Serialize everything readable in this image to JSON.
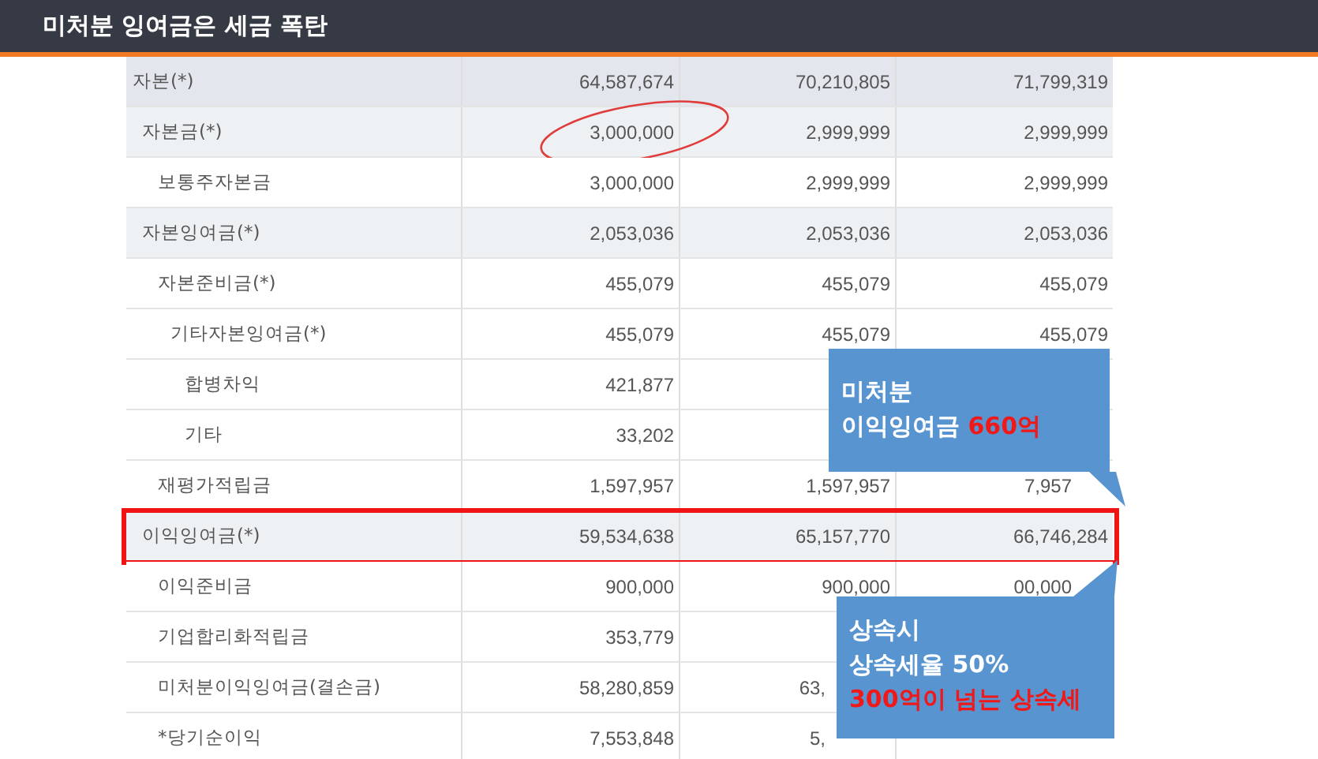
{
  "title": "미처분 잉여금은 세금 폭탄",
  "rows": [
    {
      "label": "자본(*)",
      "column_2": "64,587,674",
      "column_3": "70,210,805",
      "column_4": "71,799,319",
      "circled": false,
      "boxed": false,
      "children": [
        {
          "label": "자본금(*)",
          "column_2": "3,000,000",
          "column_3": "2,999,999",
          "column_4": "2,999,999",
          "circled": true,
          "boxed": false,
          "children": [
            {
              "label": "보통주자본금",
              "column_2": "3,000,000",
              "column_3": "2,999,999",
              "column_4": "2,999,999",
              "circled": false,
              "boxed": false
            }
          ]
        },
        {
          "label": "자본잉여금(*)",
          "column_2": "2,053,036",
          "column_3": "2,053,036",
          "column_4": "2,053,036",
          "circled": false,
          "boxed": false,
          "children": [
            {
              "label": "자본준비금(*)",
              "column_2": "455,079",
              "column_3": "455,079",
              "column_4": "455,079",
              "circled": false,
              "boxed": false,
              "children": [
                {
                  "label": "기타자본잉여금(*)",
                  "column_2": "455,079",
                  "column_3": "455,079",
                  "column_4": "455,079",
                  "circled": false,
                  "boxed": false,
                  "children": [
                    {
                      "label": "합병차익",
                      "column_2": "421,877",
                      "circled": false,
                      "boxed": false
                    },
                    {
                      "label": "기타",
                      "column_2": "33,202",
                      "circled": false,
                      "boxed": false
                    }
                  ]
                }
              ]
            },
            {
              "label": "재평가적립금",
              "column_2": "1,597,957",
              "column_3": "1,597,957",
              "column_4": {
                "text": "7,957",
                "cut": true
              },
              "circled": false,
              "boxed": false
            }
          ]
        },
        {
          "label": "이익잉여금(*)",
          "column_2": "59,534,638",
          "column_3": "65,157,770",
          "column_4": "66,746,284",
          "circled": false,
          "boxed": true,
          "children": [
            {
              "label": "이익준비금",
              "column_2": "900,000",
              "column_3": "900,000",
              "column_4": {
                "text": "00,000",
                "cut": true
              },
              "circled": false,
              "boxed": false
            },
            {
              "label": "기업합리화적립금",
              "column_2": "353,779",
              "circled": false,
              "boxed": false
            },
            {
              "label": "미처분이익잉여금(결손금)",
              "column_2": "58,280,859",
              "column_3": {
                "text": "63,",
                "cut": true
              },
              "circled": false,
              "boxed": false
            },
            {
              "label": "*당기순이익",
              "column_2": "7,553,848",
              "column_3": {
                "text": "5,",
                "cut": true
              },
              "circled": false,
              "boxed": false
            }
          ]
        }
      ]
    }
  ],
  "callouts": [
    {
      "lines": [
        {
          "text": "미처분",
          "red": false
        },
        {
          "text": "이익잉여금 **660억**",
          "red": false
        }
      ]
    },
    {
      "lines": [
        {
          "text": "상속시",
          "red": false
        },
        {
          "text": "상속세율 50%",
          "red": false
        },
        {
          "text": "300억이 넘는 상속세",
          "red": true
        }
      ]
    }
  ]
}
